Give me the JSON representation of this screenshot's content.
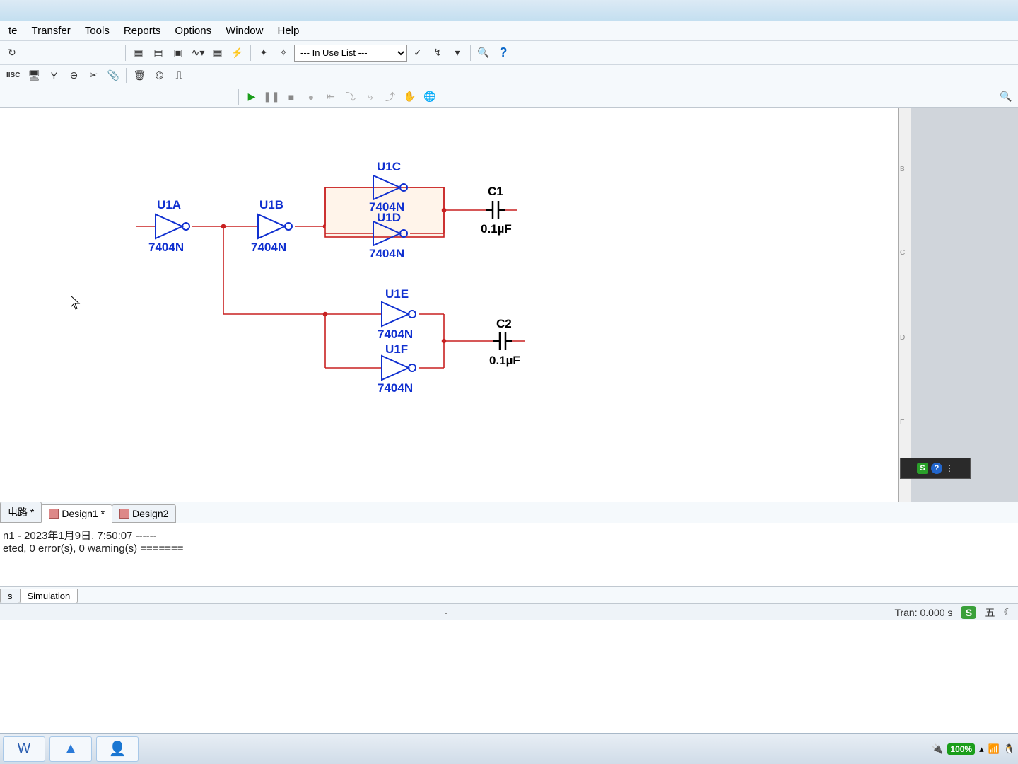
{
  "menubar": {
    "items": [
      "te",
      "Transfer",
      "Tools",
      "Reports",
      "Options",
      "Window",
      "Help"
    ],
    "accel": [
      "",
      "",
      "T",
      "R",
      "O",
      "W",
      "H"
    ]
  },
  "toolbar": {
    "in_use_list": "--- In Use List ---"
  },
  "schematic": {
    "components": {
      "u1a": {
        "ref": "U1A",
        "part": "7404N"
      },
      "u1b": {
        "ref": "U1B",
        "part": "7404N"
      },
      "u1c": {
        "ref": "U1C",
        "part": "7404N"
      },
      "u1d": {
        "ref": "U1D",
        "part": "7404N"
      },
      "u1e": {
        "ref": "U1E",
        "part": "7404N"
      },
      "u1f": {
        "ref": "U1F",
        "part": "7404N"
      },
      "c1": {
        "ref": "C1",
        "value": "0.1µF"
      },
      "c2": {
        "ref": "C2",
        "value": "0.1µF"
      }
    },
    "rail": {
      "b": "B",
      "c": "C",
      "d": "D",
      "e": "E"
    }
  },
  "tabs": {
    "t0": "电路 *",
    "t1": "Design1 *",
    "t2": "Design2"
  },
  "output": {
    "line1": "n1 - 2023年1月9日, 7:50:07 ------",
    "line2": "eted, 0 error(s), 0 warning(s) =======",
    "tabs": {
      "left": "s",
      "sim": "Simulation"
    }
  },
  "status": {
    "dash": "-",
    "tran": "Tran: 0.000 s"
  },
  "ime": {
    "label": "五"
  },
  "tray": {
    "battery": "100%"
  }
}
